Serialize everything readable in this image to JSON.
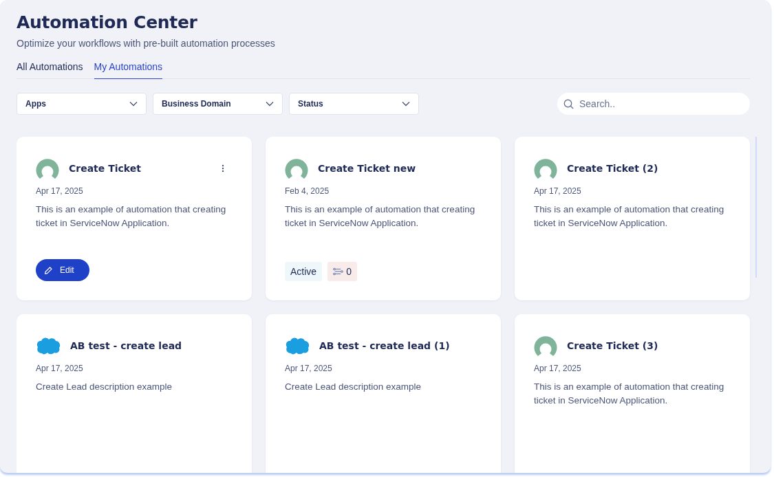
{
  "header": {
    "title": "Automation Center",
    "subtitle": "Optimize your workflows with pre-built automation processes"
  },
  "tabs": [
    {
      "label": "All Automations",
      "selected": false
    },
    {
      "label": "My Automations",
      "selected": true
    }
  ],
  "filters": [
    {
      "label": "Apps"
    },
    {
      "label": "Business Domain"
    },
    {
      "label": "Status"
    }
  ],
  "search": {
    "placeholder": "Search.."
  },
  "cards": [
    {
      "kind": "avatar",
      "title": "Create Ticket",
      "date": "Apr 17, 2025",
      "description": "This is an example of automation that creating ticket in ServiceNow Application.",
      "menu": true,
      "edit_button": "Edit"
    },
    {
      "kind": "avatar",
      "title": "Create Ticket new",
      "date": "Feb 4, 2025",
      "description": "This is an example of automation that creating ticket in ServiceNow Application.",
      "menu": false,
      "status": "Active",
      "count": "0"
    },
    {
      "kind": "avatar",
      "title": "Create Ticket (2)",
      "date": "Apr 17, 2025",
      "description": "This is an example of automation that creating ticket in ServiceNow Application.",
      "menu": false
    },
    {
      "kind": "cloud",
      "title": "AB test - create lead",
      "date": "Apr 17, 2025",
      "description": "Create Lead description example",
      "menu": false
    },
    {
      "kind": "cloud",
      "title": "AB test - create lead (1)",
      "date": "Apr 17, 2025",
      "description": "Create Lead description example",
      "menu": false
    },
    {
      "kind": "avatar",
      "title": "Create Ticket (3)",
      "date": "Apr 17, 2025",
      "description": "This is an example of automation that creating ticket in ServiceNow Application.",
      "menu": false
    }
  ]
}
